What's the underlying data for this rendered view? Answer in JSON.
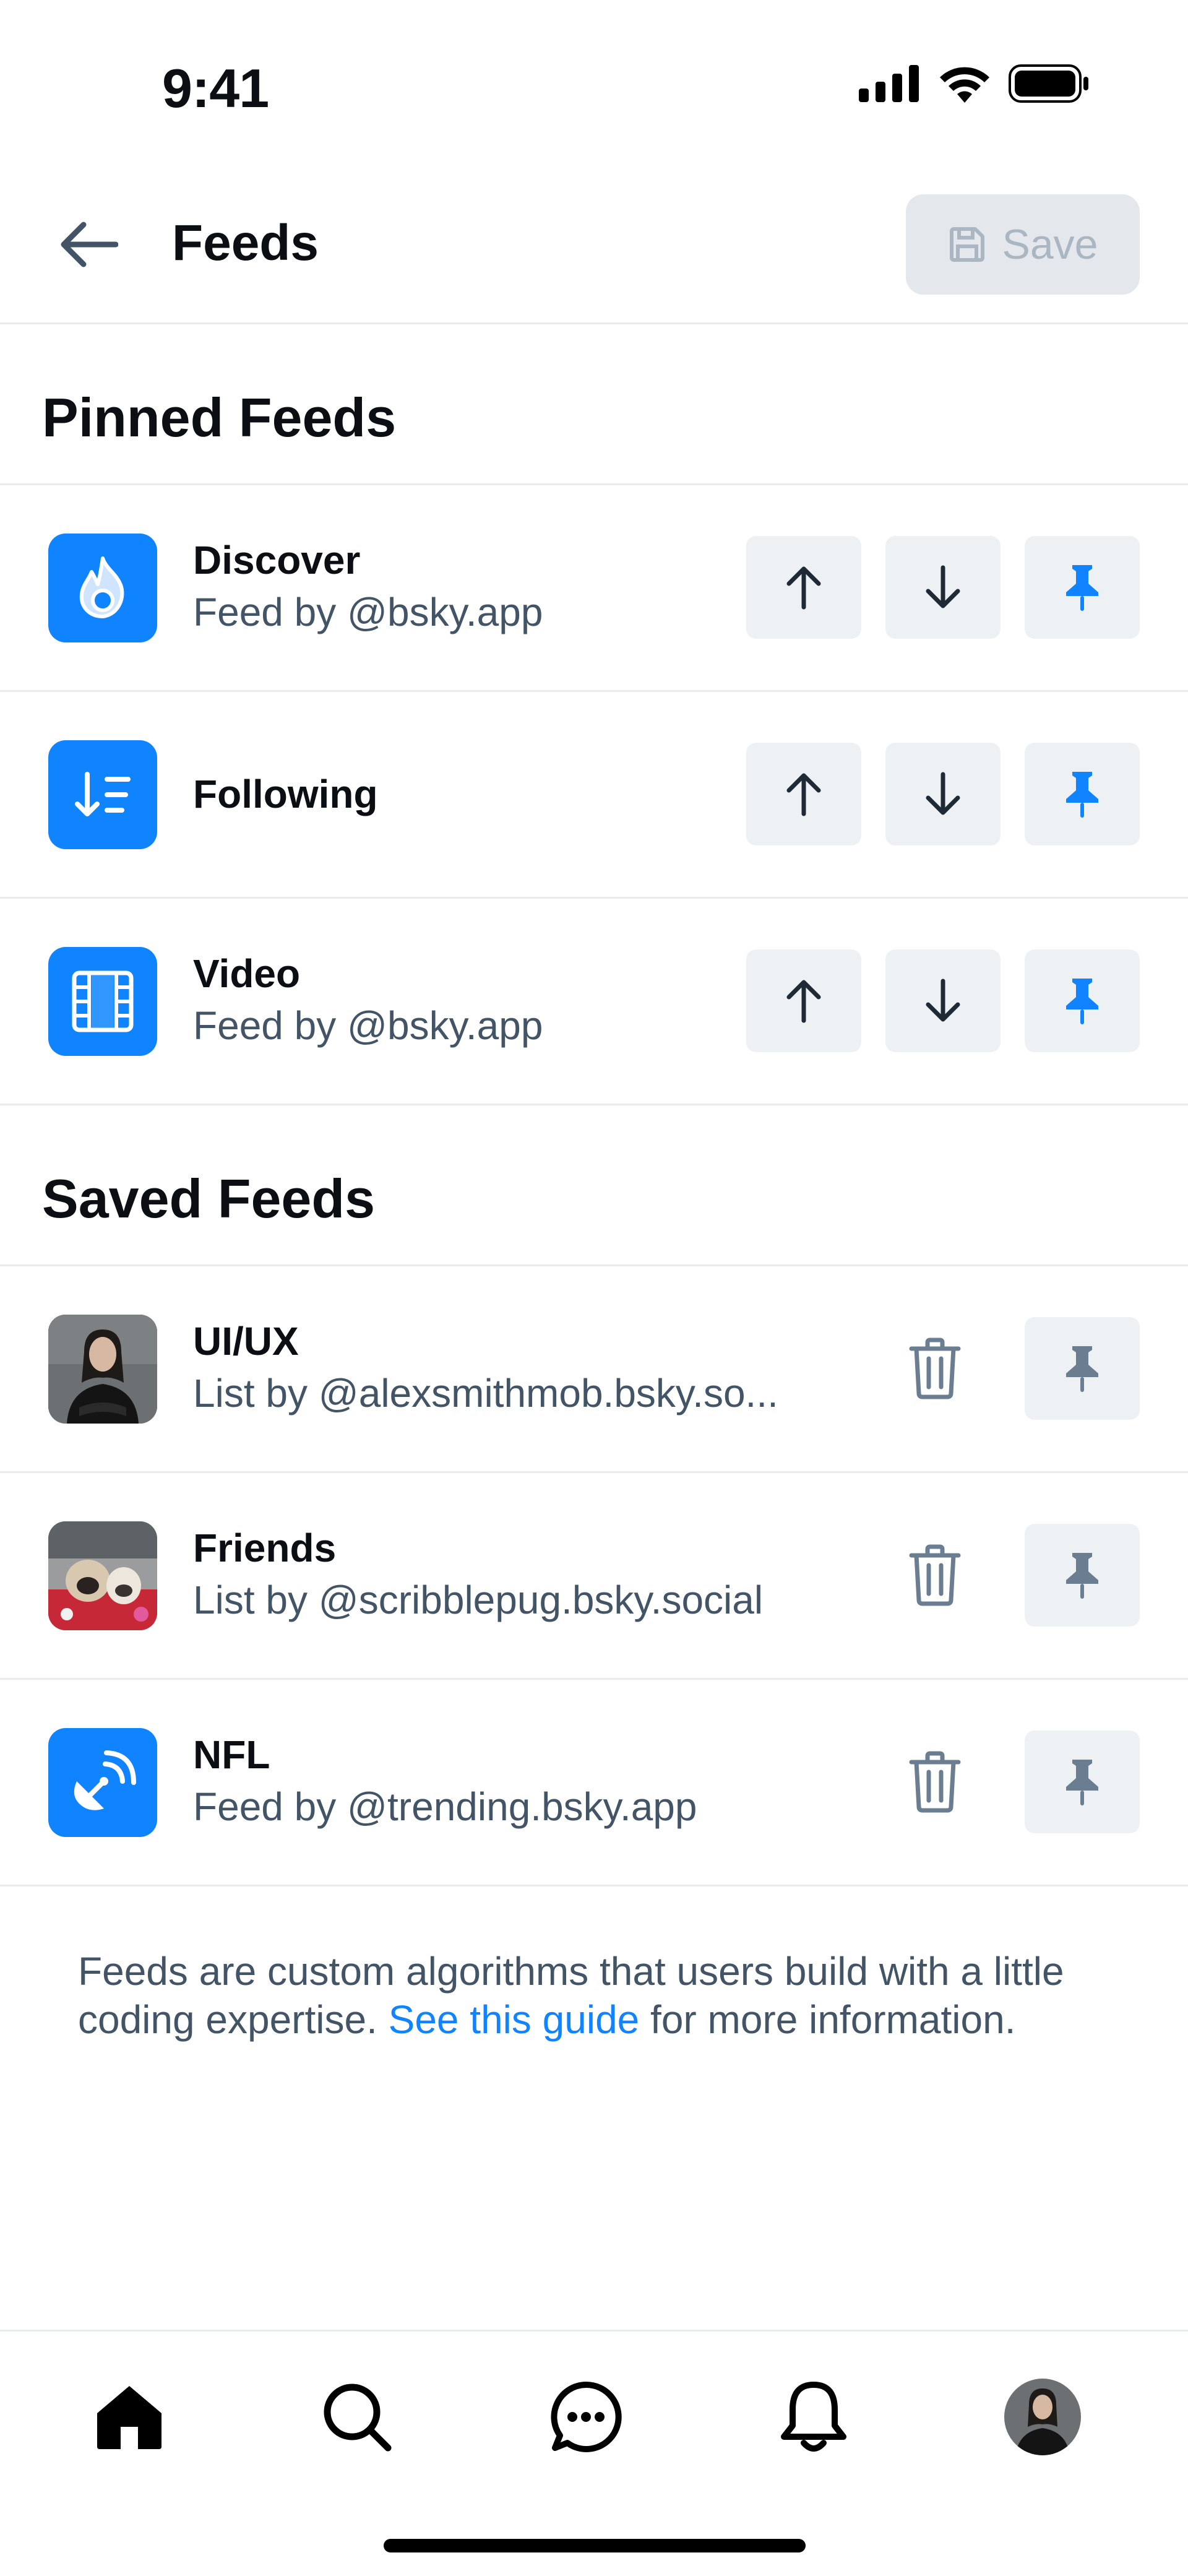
{
  "status_bar": {
    "time": "9:41"
  },
  "header": {
    "title": "Feeds",
    "save_label": "Save"
  },
  "pinned": {
    "title": "Pinned Feeds",
    "items": [
      {
        "name": "Discover",
        "sub": "Feed by @bsky.app",
        "icon": "flame-icon"
      },
      {
        "name": "Following",
        "sub": "",
        "icon": "sort-list-icon"
      },
      {
        "name": "Video",
        "sub": "Feed by @bsky.app",
        "icon": "film-icon"
      }
    ]
  },
  "saved": {
    "title": "Saved Feeds",
    "items": [
      {
        "name": "UI/UX",
        "sub": "List by @alexsmithmob.bsky.so...",
        "icon": "person-photo-avatar"
      },
      {
        "name": "Friends",
        "sub": "List by @scribblepug.bsky.social",
        "icon": "pug-photo-avatar"
      },
      {
        "name": "NFL",
        "sub": "Feed by @trending.bsky.app",
        "icon": "satellite-dish-icon"
      }
    ]
  },
  "info": {
    "text_before": "Feeds are custom algorithms that users build with a little coding expertise. ",
    "link": "See this guide",
    "text_after": " for more information."
  },
  "colors": {
    "accent": "#1083fe",
    "muted_button": "#eef1f4",
    "icon_gray": "#425466",
    "pin_gray": "#6b7d90"
  }
}
